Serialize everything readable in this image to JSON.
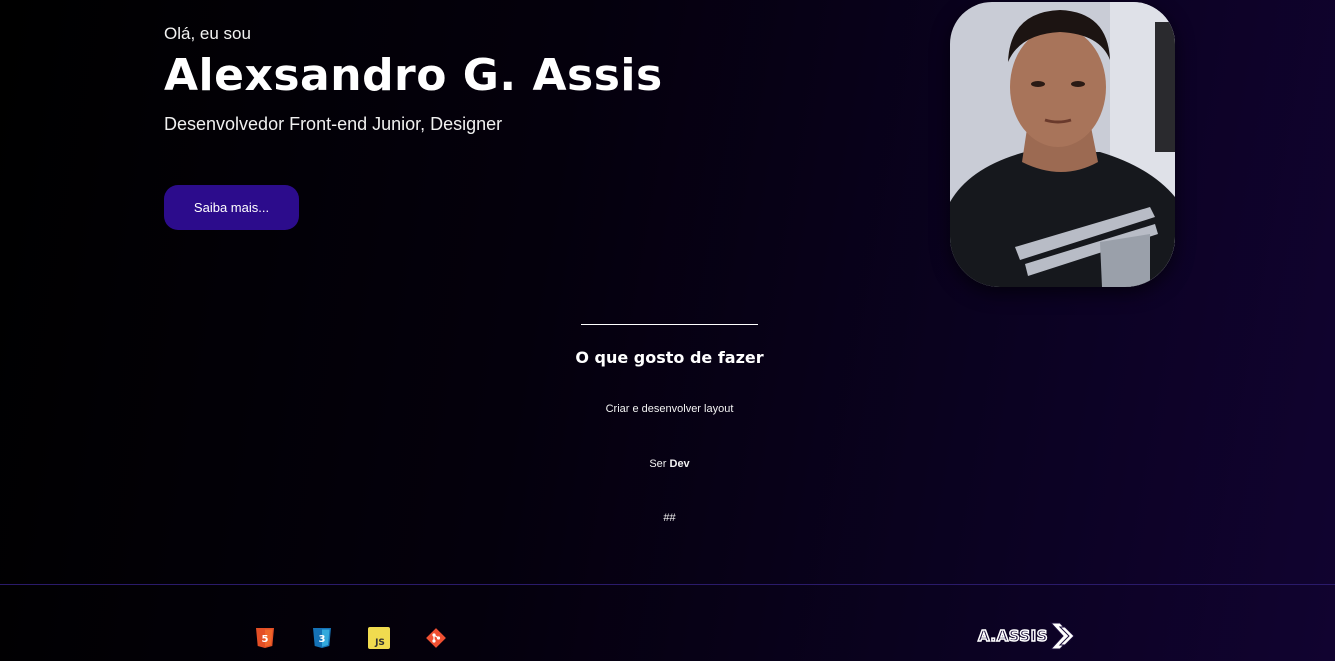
{
  "hero": {
    "greeting": "Olá, eu sou",
    "name": "Alexsandro G. Assis",
    "subtitle": "Desenvolvedor Front-end Junior, Designer",
    "cta_label": "Saiba mais..."
  },
  "colors": {
    "button": "#2c0c8c",
    "background_start": "#000000",
    "background_end": "#110330"
  },
  "about": {
    "title": "O que gosto de fazer",
    "items": [
      {
        "text": "Criar e desenvolver layout"
      },
      {
        "prefix": "Ser ",
        "bold": "Dev"
      },
      {
        "text": "##"
      }
    ]
  },
  "footer": {
    "tech_icons": [
      {
        "name": "html5-icon",
        "label": "5",
        "color": "#e34f26"
      },
      {
        "name": "css3-icon",
        "label": "3",
        "color": "#1572b6"
      },
      {
        "name": "javascript-icon",
        "label": "JS",
        "color": "#f0db4f"
      },
      {
        "name": "git-icon",
        "label": "",
        "color": "#f05032"
      }
    ],
    "logo_text": "A.ASSIS"
  }
}
